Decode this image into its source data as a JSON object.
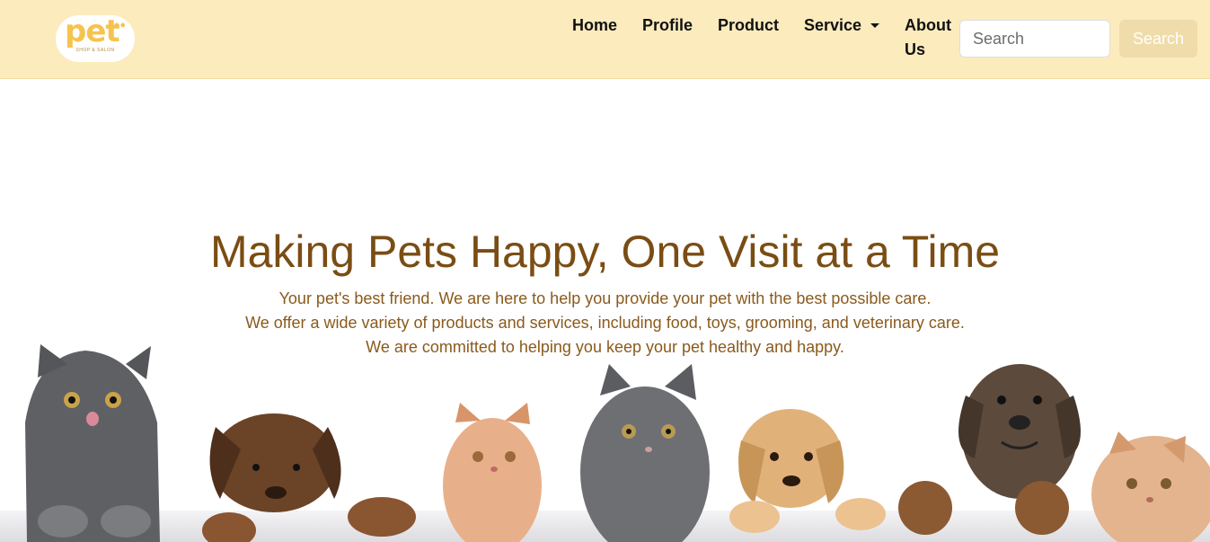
{
  "brand": {
    "logo_word": "pet",
    "logo_tagline": "SHOP & SALON",
    "color": "#f6c34e"
  },
  "nav": {
    "home": "Home",
    "profile": "Profile",
    "product": "Product",
    "service": "Service",
    "about": "About Us",
    "background": "#fcebbd"
  },
  "search": {
    "placeholder": "Search",
    "button_label": "Search"
  },
  "hero": {
    "title": "Making Pets Happy, One Visit at a Time",
    "line1": "Your pet's best friend. We are here to help you provide your pet with the best possible care.",
    "line2": "We offer a wide variety of products and services, including food, toys, grooming, and veterinary care.",
    "line3": "We are committed to helping you keep your pet healthy and happy.",
    "title_color": "#7a4d14"
  },
  "pets_image": {
    "animals": [
      "gray-kitten-icon",
      "brown-puppy-icon",
      "ginger-kitten-icon",
      "gray-fluffy-kitten-icon",
      "golden-puppy-icon",
      "dark-puppy-icon",
      "ginger-cat-icon"
    ]
  }
}
